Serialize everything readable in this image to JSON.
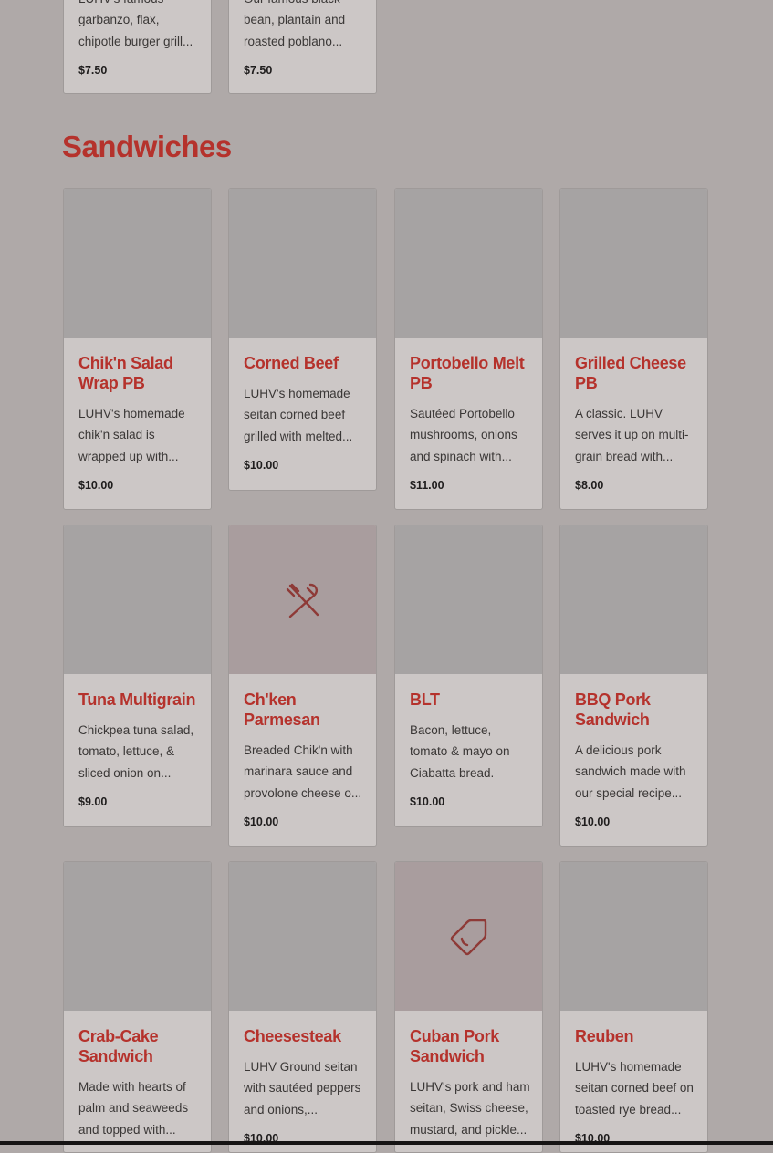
{
  "prev_section": {
    "items": [
      {
        "desc": "LUHV's famous garbanzo, flax, chipotle burger grill...",
        "price": "$7.50"
      },
      {
        "desc": "Our famous black bean, plantain and roasted poblano...",
        "price": "$7.50"
      }
    ]
  },
  "section": {
    "title": "Sandwiches",
    "items": [
      {
        "name": "Chik'n Salad Wrap PB",
        "desc": "LUHV's homemade chik'n salad is wrapped up with...",
        "price": "$10.00",
        "image": "photo"
      },
      {
        "name": "Corned Beef",
        "desc": "LUHV's homemade seitan corned beef grilled with melted...",
        "price": "$10.00",
        "image": "photo"
      },
      {
        "name": "Portobello Melt PB",
        "desc": "Sautéed Portobello mushrooms, onions and spinach with...",
        "price": "$11.00",
        "image": "photo"
      },
      {
        "name": "Grilled Cheese PB",
        "desc": "A classic. LUHV serves it up on multi-grain bread with...",
        "price": "$8.00",
        "image": "photo"
      },
      {
        "name": "Tuna Multigrain",
        "desc": "Chickpea tuna salad, tomato, lettuce, & sliced onion on...",
        "price": "$9.00",
        "image": "photo"
      },
      {
        "name": "Ch'ken Parmesan",
        "desc": "Breaded Chik'n with marinara sauce and provolone cheese o...",
        "price": "$10.00",
        "image": "utensils-icon"
      },
      {
        "name": "BLT",
        "desc": "Bacon, lettuce, tomato & mayo on Ciabatta bread.",
        "price": "$10.00",
        "image": "photo"
      },
      {
        "name": "BBQ Pork Sandwich",
        "desc": "A delicious pork sandwich made with our special recipe...",
        "price": "$10.00",
        "image": "photo"
      },
      {
        "name": "Crab-Cake Sandwich",
        "desc": "Made with hearts of palm and seaweeds and topped with...",
        "price": "",
        "image": "photo"
      },
      {
        "name": "Cheesesteak",
        "desc": "LUHV Ground seitan with sautéed peppers and onions,...",
        "price": "$10.00",
        "image": "photo"
      },
      {
        "name": "Cuban Pork Sandwich",
        "desc": "LUHV's pork and ham seitan, Swiss cheese, mustard, and pickle...",
        "price": "",
        "image": "tag-icon"
      },
      {
        "name": "Reuben",
        "desc": "LUHV's homemade seitan corned beef on toasted rye bread...",
        "price": "$10.00",
        "image": "photo"
      }
    ]
  },
  "colors": {
    "accent": "#b5322c",
    "overlay_bg": "#afa9a8",
    "card_bg": "#ccc7c6"
  }
}
